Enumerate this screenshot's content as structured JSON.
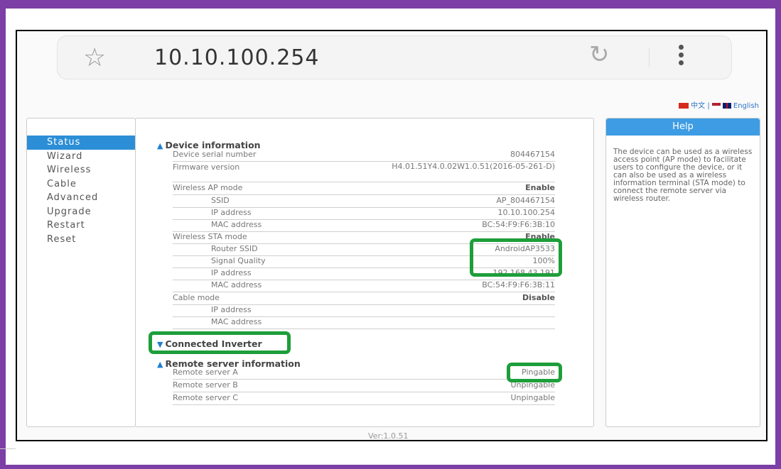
{
  "browser": {
    "url": "10.10.100.254",
    "star_icon": "star-icon",
    "reload_icon": "reload-icon",
    "menu_icon": "kebab-menu-icon"
  },
  "lang": {
    "chinese": "中文",
    "separator": "|",
    "english": "English"
  },
  "nav": [
    "Status",
    "Wizard",
    "Wireless",
    "Cable",
    "Advanced",
    "Upgrade",
    "Restart",
    "Reset"
  ],
  "device": {
    "title": "Device information",
    "serial_label": "Device serial number",
    "serial": "804467154",
    "firmware_label": "Firmware version",
    "firmware": "H4.01.51Y4.0.02W1.0.51(2016-05-261-D)",
    "ap_mode_label": "Wireless AP mode",
    "ap_mode": "Enable",
    "ap_ssid_label": "SSID",
    "ap_ssid": "AP_804467154",
    "ap_ip_label": "IP address",
    "ap_ip": "10.10.100.254",
    "ap_mac_label": "MAC address",
    "ap_mac": "BC:54:F9:F6:3B:10",
    "sta_mode_label": "Wireless STA mode",
    "sta_mode": "Enable",
    "router_ssid_label": "Router SSID",
    "router_ssid": "AndroidAP3533",
    "signal_label": "Signal Quality",
    "signal": "100%",
    "sta_ip_label": "IP address",
    "sta_ip": "192.168.43.191",
    "sta_mac_label": "MAC address",
    "sta_mac": "BC:54:F9:F6:3B:11",
    "cable_mode_label": "Cable mode",
    "cable_mode": "Disable",
    "cable_ip_label": "IP address",
    "cable_mac_label": "MAC address"
  },
  "inverter": {
    "title": "Connected Inverter"
  },
  "remote": {
    "title": "Remote server information",
    "a_label": "Remote server A",
    "a": "Pingable",
    "b_label": "Remote server B",
    "b": "Unpingable",
    "c_label": "Remote server C",
    "c": "Unpingable"
  },
  "help": {
    "title": "Help",
    "text": "The device can be used as a wireless access point (AP mode) to facilitate users to configure the device, or it can also be used as a wireless information terminal (STA mode) to connect the remote server via wireless router."
  },
  "footer": {
    "version": "Ver:1.0.51"
  },
  "colors": {
    "frame": "#7b3fa6",
    "highlight": "#1e9e3a",
    "accent": "#2c8ed6"
  }
}
